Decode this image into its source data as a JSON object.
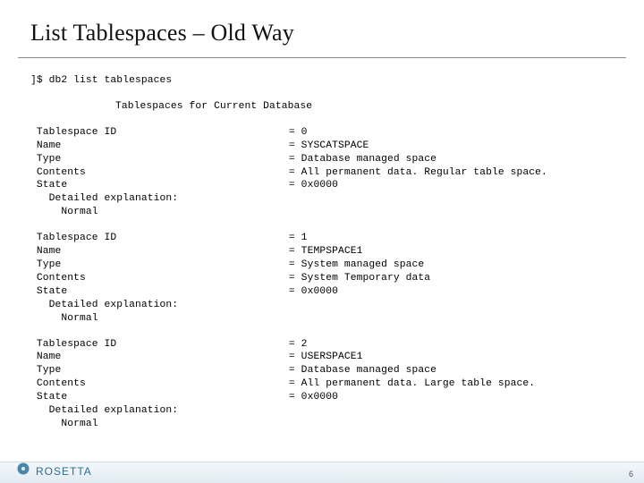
{
  "title": "List Tablespaces – Old Way",
  "command": "]$ db2 list tablespaces",
  "section_title": "Tablespaces for Current Database",
  "field_width": 33,
  "key_width": 42,
  "blocks": [
    {
      "rows": [
        {
          "label": " Tablespace ID",
          "value": "0"
        },
        {
          "label": " Name",
          "value": "SYSCATSPACE"
        },
        {
          "label": " Type",
          "value": "Database managed space"
        },
        {
          "label": " Contents",
          "value": "All permanent data. Regular table space."
        },
        {
          "label": " State",
          "value": "0x0000"
        }
      ],
      "tail": [
        "   Detailed explanation:",
        "     Normal"
      ]
    },
    {
      "rows": [
        {
          "label": " Tablespace ID",
          "value": "1"
        },
        {
          "label": " Name",
          "value": "TEMPSPACE1"
        },
        {
          "label": " Type",
          "value": "System managed space"
        },
        {
          "label": " Contents",
          "value": "System Temporary data"
        },
        {
          "label": " State",
          "value": "0x0000"
        }
      ],
      "tail": [
        "   Detailed explanation:",
        "     Normal"
      ]
    },
    {
      "rows": [
        {
          "label": " Tablespace ID",
          "value": "2"
        },
        {
          "label": " Name",
          "value": "USERSPACE1"
        },
        {
          "label": " Type",
          "value": "Database managed space"
        },
        {
          "label": " Contents",
          "value": "All permanent data. Large table space."
        },
        {
          "label": " State",
          "value": "0x0000"
        }
      ],
      "tail": [
        "   Detailed explanation:",
        "     Normal"
      ]
    }
  ],
  "footer": {
    "logo_text": "ROSETTA",
    "page": "6"
  }
}
